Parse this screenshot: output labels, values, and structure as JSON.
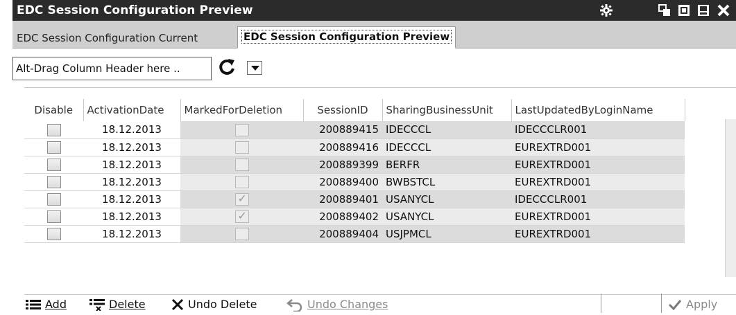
{
  "window": {
    "title": "EDC Session Configuration Preview",
    "controls": [
      "gear-icon",
      "restore-icon",
      "maximize-icon",
      "minimize-icon",
      "close-icon"
    ]
  },
  "tabs": [
    {
      "label": "EDC Session Configuration Current",
      "active": false
    },
    {
      "label": "EDC Session Configuration Preview",
      "active": true
    }
  ],
  "groupbar": {
    "text": "Alt-Drag Column Header here ..",
    "refresh_icon": "refresh-icon",
    "dropdown_icon": "dropdown-arrow-icon"
  },
  "grid": {
    "columns": [
      "Disable",
      "ActivationDate",
      "MarkedForDeletion",
      "SessionID",
      "SharingBusinessUnit",
      "LastUpdatedByLoginName"
    ],
    "rows": [
      {
        "disable": false,
        "activation_date": "18.12.2013",
        "marked_for_deletion": false,
        "session_id": "200889415",
        "sharing_business_unit": "IDECCCL",
        "last_updated_by": "IDECCCLR001"
      },
      {
        "disable": false,
        "activation_date": "18.12.2013",
        "marked_for_deletion": false,
        "session_id": "200889416",
        "sharing_business_unit": "IDECCCL",
        "last_updated_by": "EUREXTRD001"
      },
      {
        "disable": false,
        "activation_date": "18.12.2013",
        "marked_for_deletion": false,
        "session_id": "200889399",
        "sharing_business_unit": "BERFR",
        "last_updated_by": "EUREXTRD001"
      },
      {
        "disable": false,
        "activation_date": "18.12.2013",
        "marked_for_deletion": false,
        "session_id": "200889400",
        "sharing_business_unit": "BWBSTCL",
        "last_updated_by": "EUREXTRD001"
      },
      {
        "disable": false,
        "activation_date": "18.12.2013",
        "marked_for_deletion": true,
        "session_id": "200889401",
        "sharing_business_unit": "USANYCL",
        "last_updated_by": "IDECCCLR001"
      },
      {
        "disable": false,
        "activation_date": "18.12.2013",
        "marked_for_deletion": true,
        "session_id": "200889402",
        "sharing_business_unit": "USANYCL",
        "last_updated_by": "EUREXTRD001"
      },
      {
        "disable": false,
        "activation_date": "18.12.2013",
        "marked_for_deletion": false,
        "session_id": "200889404",
        "sharing_business_unit": "USJPMCL",
        "last_updated_by": "EUREXTRD001"
      }
    ]
  },
  "toolbar": {
    "add_label": "Add",
    "delete_label": "Delete",
    "undo_delete_label": "Undo Delete",
    "undo_changes_label": "Undo Changes",
    "apply_label": "Apply"
  },
  "colors": {
    "titlebar": "#2b2b2b",
    "tabbar": "#cfcfcf",
    "cell_gray": "#dcdcdc",
    "cell_light": "#ebebeb"
  }
}
